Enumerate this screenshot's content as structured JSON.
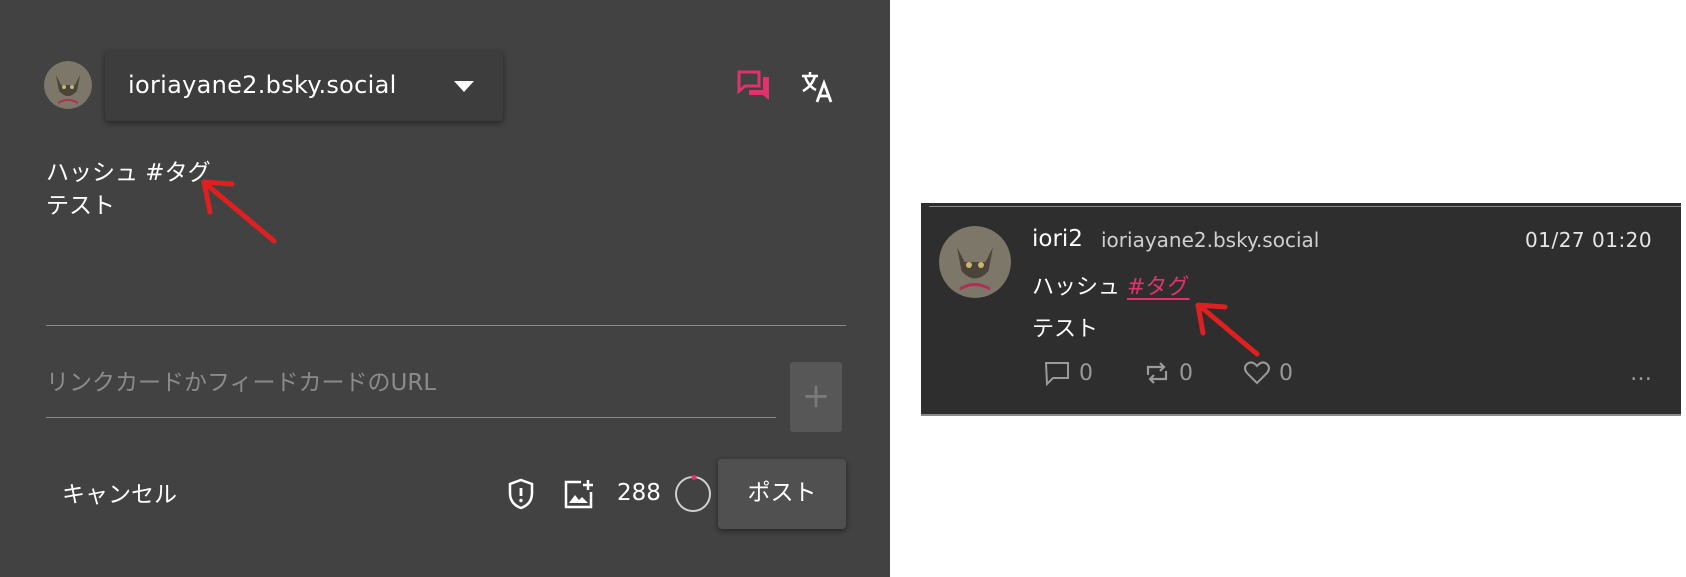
{
  "composer": {
    "account_handle": "ioriayane2.bsky.social",
    "text_line1": "ハッシュ #タグ",
    "text_line2": "テスト",
    "url_placeholder": "リンクカードかフィードカードのURL",
    "add_label": "+",
    "cancel_label": "キャンセル",
    "char_count": "288",
    "post_label": "ポスト",
    "icons": [
      "thread-icon",
      "translate-icon",
      "shield-icon",
      "add-image-icon",
      "progress-ring-icon"
    ]
  },
  "post": {
    "display_name": "iori2",
    "handle": "ioriayane2.bsky.social",
    "timestamp": "01/27 01:20",
    "text_prefix": "ハッシュ ",
    "hashtag": "#タグ",
    "text_line2": "テスト",
    "reply_count": "0",
    "repost_count": "0",
    "like_count": "0",
    "more_label": "…"
  },
  "colors": {
    "accent": "#e0336e",
    "arrow": "#e02020",
    "composer_bg": "#424242",
    "card_bg": "#2e2e2e"
  }
}
